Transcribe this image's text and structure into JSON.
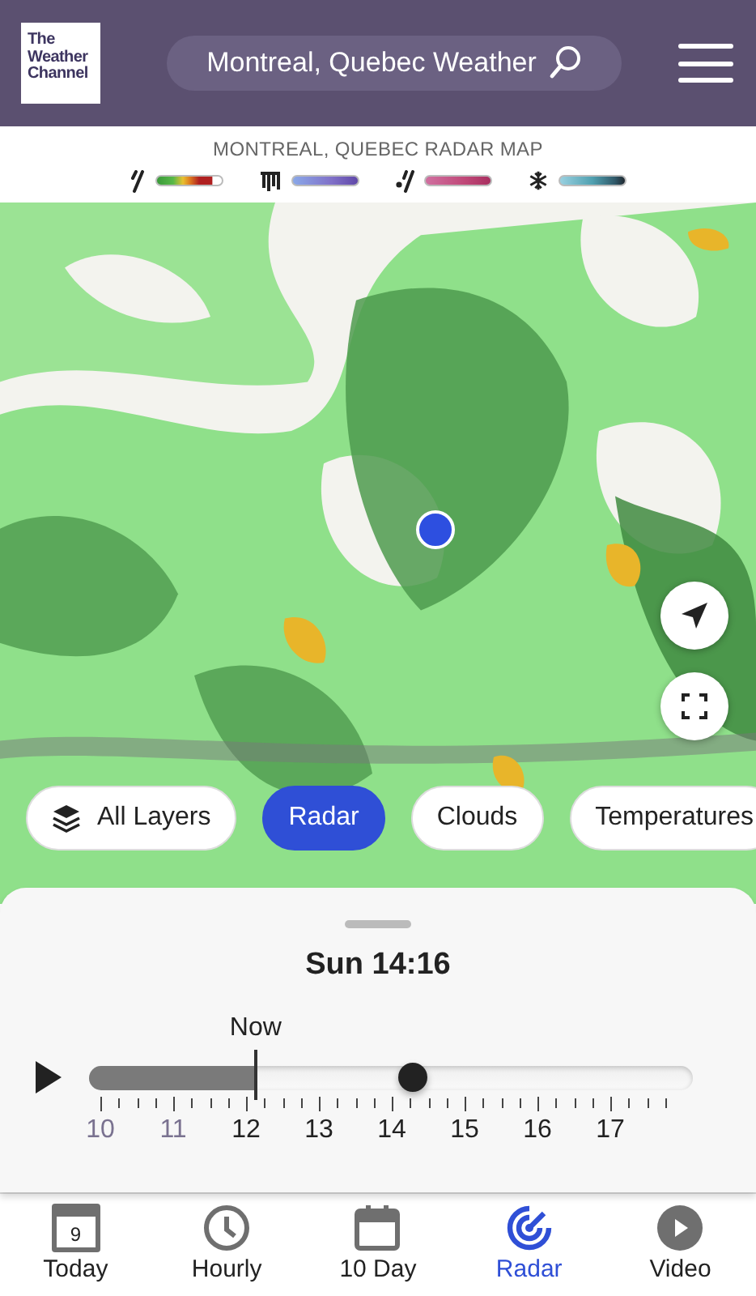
{
  "header": {
    "logo": "The\nWeather\nChannel",
    "search": {
      "value": "Montreal, Quebec Weather"
    }
  },
  "legend": {
    "title": "MONTREAL, QUEBEC RADAR MAP",
    "items": [
      {
        "kind": "rain"
      },
      {
        "kind": "ice"
      },
      {
        "kind": "mix"
      },
      {
        "kind": "snow"
      }
    ]
  },
  "map": {
    "kind": "picture",
    "layers": [
      {
        "label": "All Layers",
        "kind": "layers",
        "selected": false
      },
      {
        "label": "Radar",
        "kind": "plain",
        "selected": true
      },
      {
        "label": "Clouds",
        "kind": "plain",
        "selected": false
      },
      {
        "label": "Temperatures",
        "kind": "plain",
        "selected": false
      }
    ]
  },
  "timeline": {
    "time": "Sun 14:16",
    "now_marker": {
      "label": "Now",
      "level": 0.276
    },
    "level": 0.536,
    "ticks": [
      {
        "label": "10",
        "past": true
      },
      {
        "label": "11",
        "past": true
      },
      {
        "label": "12",
        "past": false
      },
      {
        "label": "13",
        "past": false
      },
      {
        "label": "14",
        "past": false
      },
      {
        "label": "15",
        "past": false
      },
      {
        "label": "16",
        "past": false
      },
      {
        "label": "17",
        "past": false
      }
    ]
  },
  "nav": [
    {
      "label": "Today",
      "kind": "today",
      "icon_text": "9",
      "selected": false
    },
    {
      "label": "Hourly",
      "kind": "hourly",
      "selected": false
    },
    {
      "label": "10 Day",
      "kind": "tenday",
      "selected": false
    },
    {
      "label": "Radar",
      "kind": "radar",
      "selected": true
    },
    {
      "label": "Video",
      "kind": "video",
      "selected": false
    }
  ]
}
